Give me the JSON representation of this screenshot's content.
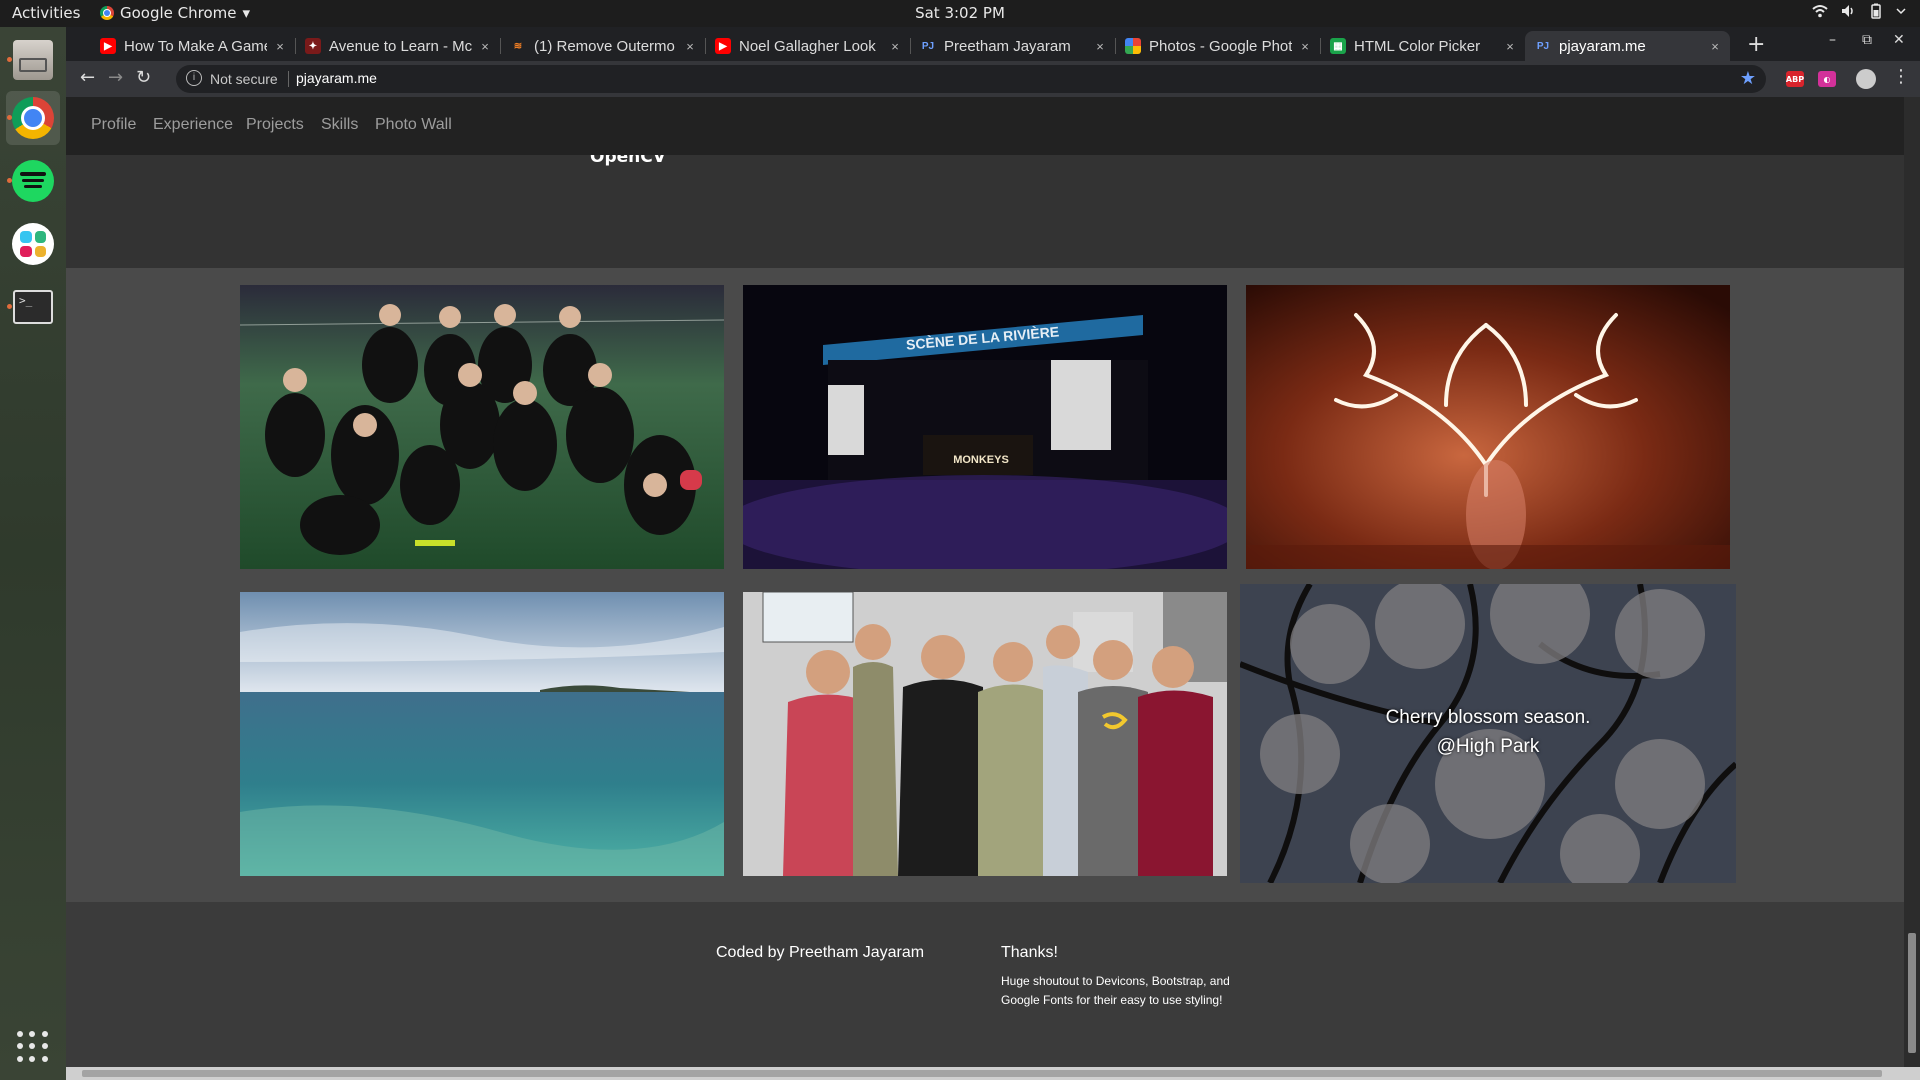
{
  "system": {
    "activities": "Activities",
    "app_menu": "Google Chrome",
    "app_menu_arrow": "▾",
    "clock": "Sat  3:02 PM",
    "tray": [
      "wifi-icon",
      "volume-icon",
      "battery-icon"
    ]
  },
  "dock": [
    "files",
    "google-chrome",
    "spotify",
    "slack",
    "terminal",
    "show-applications"
  ],
  "browser": {
    "tabs": [
      {
        "title": "How To Make A Game",
        "icon": "youtube-icon",
        "active": false
      },
      {
        "title": "Avenue to Learn - Mc",
        "icon": "avenue-icon",
        "active": false
      },
      {
        "title": "(1) Remove Outermo",
        "icon": "stackoverflow-icon",
        "active": false
      },
      {
        "title": "Noel Gallagher Look",
        "icon": "youtube-icon",
        "active": false
      },
      {
        "title": "Preetham Jayaram",
        "icon": "pj-icon",
        "active": false
      },
      {
        "title": "Photos - Google Phot",
        "icon": "google-photos-icon",
        "active": false
      },
      {
        "title": "HTML Color Picker",
        "icon": "colorpicker-icon",
        "active": false
      },
      {
        "title": "pjayaram.me",
        "icon": "pj-icon",
        "active": true
      }
    ],
    "tab_close": "×",
    "new_tab": "+",
    "window_controls": {
      "minimize": "–",
      "restore": "⧉",
      "close": "✕"
    },
    "nav": {
      "back": "←",
      "forward": "→",
      "reload": "↻"
    },
    "omnibox": {
      "security": "Not secure",
      "url": "pjayaram.me",
      "info_glyph": "i",
      "bookmark": "★"
    },
    "extensions": [
      {
        "label": "ABP",
        "color": "#d9242c"
      },
      {
        "label": "◐",
        "color": "#d3319a"
      }
    ],
    "menu": "⋮",
    "colors": {
      "tabstrip": "#202124",
      "toolbar": "#35363a",
      "accent": "#6ea0ff"
    }
  },
  "site": {
    "nav": [
      "Profile",
      "Experience",
      "Projects",
      "Skills",
      "Photo Wall"
    ],
    "skills_cutoff_text": "OpenCV",
    "photo_wall": [
      {
        "name": "team-photo",
        "caption": ""
      },
      {
        "name": "concert-photo",
        "caption": ""
      },
      {
        "name": "sparkler-photo",
        "caption": ""
      },
      {
        "name": "lake-photo",
        "caption": ""
      },
      {
        "name": "group-photo",
        "caption": ""
      },
      {
        "name": "cherry-blossom-photo",
        "caption": "Cherry blossom season.",
        "caption_line2": "@High Park"
      }
    ],
    "concert_stage_sign": "SCÈNE DE LA RIVIÈRE",
    "concert_band": "MONKEYS",
    "footer": {
      "coded_by": "Coded by Preetham Jayaram",
      "thanks_title": "Thanks!",
      "thanks_body": "Huge shoutout to Devicons, Bootstrap, and Google Fonts for their easy to use styling!"
    },
    "colors": {
      "nav_bg": "#222222",
      "nav_text": "#9d9d9d",
      "wall_bg": "#4a4a4a",
      "footer_bg": "#3b3b3b"
    }
  }
}
